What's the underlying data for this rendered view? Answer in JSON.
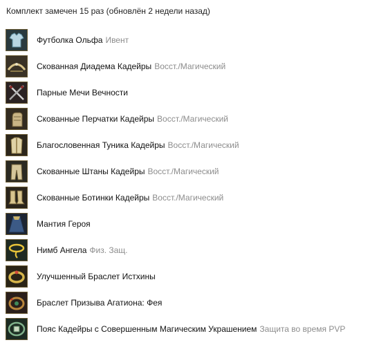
{
  "header": {
    "text": "Комплект замечен 15 раз (обновлён 2 недели назад)"
  },
  "items": [
    {
      "name": "Футболка Ольфа",
      "sub": "Ивент",
      "icon": "shirt-icon"
    },
    {
      "name": "Скованная Диадема Кадейры",
      "sub": "Восст./Магический",
      "icon": "diadem-icon"
    },
    {
      "name": "Парные Мечи Вечности",
      "sub": "",
      "icon": "swords-icon"
    },
    {
      "name": "Скованные Перчатки Кадейры",
      "sub": "Восст./Магический",
      "icon": "gloves-icon"
    },
    {
      "name": "Благословенная Туника Кадейры",
      "sub": "Восст./Магический",
      "icon": "tunic-icon"
    },
    {
      "name": "Скованные Штаны Кадейры",
      "sub": "Восст./Магический",
      "icon": "pants-icon"
    },
    {
      "name": "Скованные Ботинки Кадейры",
      "sub": "Восст./Магический",
      "icon": "boots-icon"
    },
    {
      "name": "Мантия Героя",
      "sub": "",
      "icon": "cloak-icon"
    },
    {
      "name": "Нимб Ангела",
      "sub": "Физ. Защ.",
      "icon": "halo-icon"
    },
    {
      "name": "Улучшенный Браслет Истхины",
      "sub": "",
      "icon": "bracelet-icon"
    },
    {
      "name": "Браслет Призыва Агатиона: Фея",
      "sub": "",
      "icon": "agathion-bracelet-icon"
    },
    {
      "name": "Пояс Кадейры с Совершенным Магическим Украшением",
      "sub": "Защита во время PVP",
      "icon": "belt-icon"
    }
  ]
}
